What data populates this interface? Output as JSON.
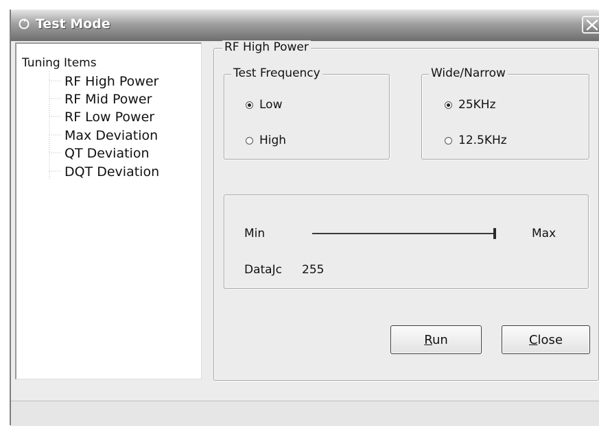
{
  "window": {
    "title": "Test Mode"
  },
  "tree": {
    "root": "Tuning Items",
    "items": [
      "RF High Power",
      "RF Mid Power",
      "RF Low Power",
      "Max Deviation",
      "QT Deviation",
      "DQT Deviation"
    ]
  },
  "panel": {
    "title": "RF High Power",
    "test_frequency": {
      "label": "Test Frequency",
      "options": [
        "Low",
        "High"
      ],
      "selected": "Low"
    },
    "wide_narrow": {
      "label": "Wide/Narrow",
      "options": [
        "25KHz",
        "12.5KHz"
      ],
      "selected": "25KHz"
    },
    "slider": {
      "min_label": "Min",
      "max_label": "Max",
      "value_fraction": 1.0
    },
    "data": {
      "label": "DataJc",
      "value": "255"
    }
  },
  "buttons": {
    "run": {
      "label": "Run",
      "accesskey": "R"
    },
    "close": {
      "label": "Close",
      "accesskey": "C"
    }
  },
  "icons": {
    "title": "refresh-icon",
    "close": "close-icon"
  }
}
